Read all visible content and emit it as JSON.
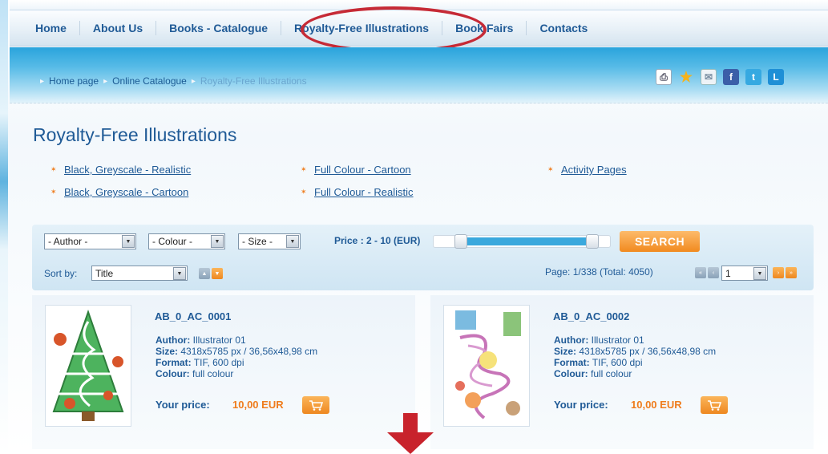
{
  "nav": {
    "items": [
      {
        "label": "Home"
      },
      {
        "label": "About Us"
      },
      {
        "label": "Books - Catalogue"
      },
      {
        "label": "Royalty-Free Illustrations"
      },
      {
        "label": "Book Fairs"
      },
      {
        "label": "Contacts"
      }
    ]
  },
  "breadcrumb": {
    "items": [
      "Home page",
      "Online Catalogue",
      "Royalty-Free Illustrations"
    ]
  },
  "share_icons": [
    "print-icon",
    "star-icon",
    "mail-icon",
    "facebook-icon",
    "twitter-icon",
    "linkedin-icon"
  ],
  "page": {
    "title": "Royalty-Free Illustrations"
  },
  "categories": [
    {
      "label": "Black, Greyscale - Realistic"
    },
    {
      "label": "Black, Greyscale - Cartoon"
    },
    {
      "label": "Full Colour - Cartoon"
    },
    {
      "label": "Full Colour - Realistic"
    },
    {
      "label": "Activity Pages"
    }
  ],
  "filters": {
    "author": "- Author -",
    "colour": "- Colour -",
    "size": "- Size -",
    "price_label": "Price : 2 - 10 (EUR)",
    "price_range": [
      2,
      10
    ],
    "search_label": "SEARCH",
    "sort_label": "Sort by:",
    "sort_value": "Title",
    "page_info": "Page: 1/338 (Total: 4050)",
    "page_select": "1"
  },
  "products": [
    {
      "code": "AB_0_AC_0001",
      "author_label": "Author:",
      "author": "Illustrator 01",
      "size_label": "Size:",
      "size": "4318x5785 px / 36,56x48,98 cm",
      "format_label": "Format:",
      "format": "TIF, 600 dpi",
      "colour_label": "Colour:",
      "colour": "full colour",
      "price_label": "Your price:",
      "price": "10,00 EUR"
    },
    {
      "code": "AB_0_AC_0002",
      "author_label": "Author:",
      "author": "Illustrator 01",
      "size_label": "Size:",
      "size": "4318x5785 px / 36,56x48,98 cm",
      "format_label": "Format:",
      "format": "TIF, 600 dpi",
      "colour_label": "Colour:",
      "colour": "full colour",
      "price_label": "Your price:",
      "price": "10,00 EUR"
    }
  ],
  "colors": {
    "primary": "#1f5a96",
    "accent_orange": "#ef7c1c",
    "band_blue": "#2aa4dc",
    "highlight_circle": "#c62a36",
    "arrow_red": "#c8232c"
  }
}
